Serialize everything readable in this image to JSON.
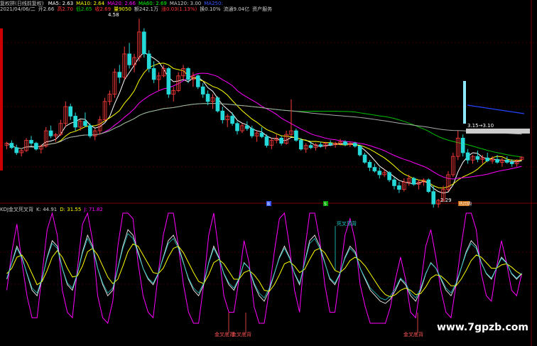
{
  "header": {
    "title": "复权拼(日线前复权)",
    "ma": [
      {
        "label": "MA5: 2.63",
        "color": "#ffffff"
      },
      {
        "label": "MA10: 2.64",
        "color": "#ffff00"
      },
      {
        "label": "MA20: 2.66",
        "color": "#ff00ff"
      },
      {
        "label": "MA60: 2.69",
        "color": "#00ff00"
      },
      {
        "label": "MA120: 3.00",
        "color": "#cccccc"
      },
      {
        "label": "MA250:",
        "color": "#3355ff"
      }
    ],
    "info": [
      {
        "label": "2021/04/06/二",
        "color": "#cccccc"
      },
      {
        "label": "开2.66",
        "color": "#cccccc"
      },
      {
        "label": "高2.70",
        "color": "#ff3333"
      },
      {
        "label": "低2.65",
        "color": "#00cc00"
      },
      {
        "label": "收2.69",
        "color": "#ff3333"
      },
      {
        "label": "量9050",
        "color": "#ffff00"
      },
      {
        "label": "额242.1万",
        "color": "#cccccc"
      },
      {
        "label": "涨0.03(1.13%)",
        "color": "#ff3333"
      },
      {
        "label": "换0.10%",
        "color": "#cccccc"
      },
      {
        "label": "流通9.04亿",
        "color": "#cccccc"
      },
      {
        "label": "资产服务",
        "color": "#cccccc"
      }
    ]
  },
  "kdj_header": [
    {
      "label": "KDJ金叉死叉背",
      "color": "#cccccc"
    },
    {
      "label": "K: 44.91",
      "color": "#cccccc"
    },
    {
      "label": "D: 31.55",
      "color": "#ffff00"
    },
    {
      "label": "J: 71.82",
      "color": "#ff00ff"
    }
  ],
  "markers": {
    "b1": "B",
    "b2": "S",
    "b3": "热回购"
  },
  "annotations": {
    "high": "4.58",
    "low": "2.29",
    "range": "3.15→3.10",
    "dead": "死叉顶背",
    "gold": [
      "金叉底背",
      "金叉底背",
      "金叉底背"
    ]
  },
  "colors": {
    "up": "#ff3b3b",
    "down": "#26d9d9",
    "grid": "#7a0000"
  },
  "watermark": "www.7gpzb.com",
  "chart_data": {
    "type": "candlestick",
    "price_range": [
      2.1,
      4.7
    ],
    "candles": [
      [
        2.85,
        2.9,
        2.8,
        2.88
      ],
      [
        2.88,
        2.92,
        2.8,
        2.82
      ],
      [
        2.82,
        2.86,
        2.72,
        2.75
      ],
      [
        2.75,
        2.8,
        2.7,
        2.78
      ],
      [
        2.78,
        2.95,
        2.76,
        2.92
      ],
      [
        2.92,
        2.98,
        2.85,
        2.88
      ],
      [
        2.88,
        2.9,
        2.78,
        2.8
      ],
      [
        2.8,
        2.86,
        2.74,
        2.84
      ],
      [
        2.84,
        3.1,
        2.82,
        3.05
      ],
      [
        3.05,
        3.12,
        2.95,
        2.98
      ],
      [
        2.98,
        3.02,
        2.9,
        3.0
      ],
      [
        3.0,
        3.2,
        2.98,
        3.15
      ],
      [
        3.15,
        3.45,
        3.1,
        3.38
      ],
      [
        3.38,
        3.42,
        3.2,
        3.25
      ],
      [
        3.25,
        3.3,
        3.05,
        3.1
      ],
      [
        3.1,
        3.2,
        3.05,
        3.18
      ],
      [
        3.18,
        3.3,
        3.1,
        3.12
      ],
      [
        3.12,
        3.15,
        2.95,
        2.98
      ],
      [
        2.98,
        3.08,
        2.92,
        3.05
      ],
      [
        3.05,
        3.25,
        3.0,
        3.2
      ],
      [
        3.2,
        3.5,
        3.18,
        3.45
      ],
      [
        3.45,
        3.6,
        3.4,
        3.55
      ],
      [
        3.55,
        3.9,
        3.5,
        3.85
      ],
      [
        3.85,
        3.95,
        3.7,
        3.78
      ],
      [
        3.78,
        4.2,
        3.75,
        4.1
      ],
      [
        4.1,
        4.25,
        3.9,
        3.95
      ],
      [
        3.95,
        4.1,
        3.85,
        4.05
      ],
      [
        4.05,
        4.58,
        4.0,
        4.4
      ],
      [
        4.4,
        4.45,
        4.05,
        4.1
      ],
      [
        4.1,
        4.15,
        3.85,
        3.9
      ],
      [
        3.9,
        4.0,
        3.7,
        3.75
      ],
      [
        3.75,
        3.85,
        3.6,
        3.8
      ],
      [
        3.8,
        3.95,
        3.78,
        3.9
      ],
      [
        3.9,
        3.92,
        3.5,
        3.55
      ],
      [
        3.55,
        3.65,
        3.45,
        3.6
      ],
      [
        3.6,
        3.85,
        3.58,
        3.8
      ],
      [
        3.8,
        3.95,
        3.75,
        3.9
      ],
      [
        3.9,
        3.92,
        3.7,
        3.75
      ],
      [
        3.75,
        3.85,
        3.65,
        3.8
      ],
      [
        3.8,
        3.82,
        3.62,
        3.65
      ],
      [
        3.65,
        3.7,
        3.5,
        3.55
      ],
      [
        3.55,
        3.6,
        3.4,
        3.45
      ],
      [
        3.45,
        3.55,
        3.35,
        3.5
      ],
      [
        3.5,
        3.52,
        3.3,
        3.32
      ],
      [
        3.32,
        3.38,
        3.15,
        3.2
      ],
      [
        3.2,
        3.28,
        3.1,
        3.25
      ],
      [
        3.25,
        3.3,
        3.12,
        3.15
      ],
      [
        3.15,
        3.18,
        3.0,
        3.05
      ],
      [
        3.05,
        3.15,
        3.02,
        3.12
      ],
      [
        3.12,
        3.18,
        3.05,
        3.08
      ],
      [
        3.08,
        3.12,
        2.95,
        2.98
      ],
      [
        2.98,
        3.05,
        2.9,
        3.02
      ],
      [
        3.02,
        3.1,
        2.95,
        2.97
      ],
      [
        2.97,
        3.0,
        2.82,
        2.85
      ],
      [
        2.85,
        2.95,
        2.8,
        2.92
      ],
      [
        2.92,
        3.0,
        2.88,
        2.95
      ],
      [
        2.95,
        2.98,
        2.85,
        2.88
      ],
      [
        2.88,
        3.05,
        2.86,
        3.0
      ],
      [
        3.0,
        3.48,
        2.98,
        3.05
      ],
      [
        3.05,
        3.08,
        2.9,
        2.92
      ],
      [
        2.92,
        2.95,
        2.78,
        2.8
      ],
      [
        2.8,
        2.88,
        2.75,
        2.85
      ],
      [
        2.85,
        2.9,
        2.8,
        2.82
      ],
      [
        2.82,
        2.88,
        2.78,
        2.86
      ],
      [
        2.86,
        2.9,
        2.82,
        2.84
      ],
      [
        2.84,
        2.9,
        2.8,
        2.88
      ],
      [
        2.88,
        2.92,
        2.84,
        2.86
      ],
      [
        2.86,
        2.9,
        2.82,
        2.88
      ],
      [
        2.88,
        2.94,
        2.85,
        2.9
      ],
      [
        2.9,
        2.92,
        2.84,
        2.86
      ],
      [
        2.86,
        2.9,
        2.83,
        2.88
      ],
      [
        2.88,
        2.9,
        2.82,
        2.84
      ],
      [
        2.84,
        2.86,
        2.7,
        2.72
      ],
      [
        2.72,
        2.75,
        2.6,
        2.62
      ],
      [
        2.62,
        2.65,
        2.5,
        2.55
      ],
      [
        2.55,
        2.6,
        2.48,
        2.5
      ],
      [
        2.5,
        2.55,
        2.4,
        2.45
      ],
      [
        2.45,
        2.52,
        2.42,
        2.48
      ],
      [
        2.48,
        2.5,
        2.35,
        2.38
      ],
      [
        2.38,
        2.42,
        2.25,
        2.3
      ],
      [
        2.3,
        2.35,
        2.2,
        2.25
      ],
      [
        2.25,
        2.4,
        2.22,
        2.35
      ],
      [
        2.35,
        2.45,
        2.3,
        2.4
      ],
      [
        2.4,
        2.42,
        2.3,
        2.32
      ],
      [
        2.32,
        2.38,
        2.25,
        2.35
      ],
      [
        2.35,
        2.4,
        2.3,
        2.38
      ],
      [
        2.38,
        2.4,
        2.2,
        2.22
      ],
      [
        2.22,
        2.3,
        2.0,
        2.05
      ],
      [
        2.05,
        2.12,
        2.0,
        2.1
      ],
      [
        2.1,
        2.3,
        2.08,
        2.25
      ],
      [
        2.25,
        2.5,
        2.22,
        2.45
      ],
      [
        2.45,
        2.75,
        2.42,
        2.7
      ],
      [
        2.7,
        3.05,
        2.65,
        2.95
      ],
      [
        2.95,
        3.0,
        2.7,
        2.75
      ],
      [
        2.75,
        2.8,
        2.6,
        2.65
      ],
      [
        2.65,
        2.72,
        2.6,
        2.7
      ],
      [
        2.7,
        2.78,
        2.62,
        2.66
      ],
      [
        2.66,
        2.72,
        2.6,
        2.68
      ],
      [
        2.68,
        2.75,
        2.62,
        2.64
      ],
      [
        2.64,
        2.7,
        2.6,
        2.66
      ],
      [
        2.66,
        2.72,
        2.6,
        2.62
      ],
      [
        2.62,
        2.68,
        2.56,
        2.65
      ],
      [
        2.65,
        2.7,
        2.6,
        2.62
      ],
      [
        2.62,
        2.66,
        2.56,
        2.6
      ],
      [
        2.6,
        2.66,
        2.56,
        2.64
      ],
      [
        2.66,
        2.7,
        2.65,
        2.69
      ]
    ],
    "kdj": {
      "k": [
        40,
        55,
        70,
        60,
        45,
        30,
        25,
        40,
        60,
        75,
        70,
        50,
        35,
        30,
        45,
        65,
        80,
        70,
        50,
        35,
        25,
        30,
        50,
        70,
        85,
        80,
        65,
        50,
        40,
        35,
        45,
        60,
        75,
        80,
        70,
        55,
        40,
        30,
        25,
        35,
        55,
        70,
        60,
        45,
        35,
        30,
        40,
        55,
        50,
        35,
        25,
        20,
        30,
        45,
        60,
        70,
        60,
        45,
        35,
        55,
        75,
        80,
        70,
        55,
        40,
        35,
        45,
        60,
        70,
        65,
        50,
        40,
        30,
        25,
        20,
        18,
        22,
        30,
        40,
        35,
        25,
        20,
        30,
        45,
        55,
        50,
        40,
        30,
        25,
        35,
        50,
        65,
        75,
        70,
        55,
        45,
        40,
        50,
        60,
        55,
        45,
        40,
        45
      ],
      "d": [
        45,
        50,
        60,
        62,
        55,
        45,
        35,
        38,
        48,
        60,
        66,
        60,
        50,
        42,
        43,
        52,
        65,
        68,
        62,
        52,
        42,
        36,
        40,
        52,
        65,
        72,
        70,
        62,
        54,
        46,
        45,
        50,
        60,
        68,
        70,
        64,
        55,
        46,
        38,
        36,
        44,
        55,
        58,
        54,
        47,
        40,
        40,
        46,
        48,
        44,
        38,
        30,
        29,
        35,
        44,
        54,
        56,
        52,
        46,
        49,
        58,
        66,
        68,
        64,
        56,
        48,
        46,
        50,
        57,
        60,
        57,
        52,
        45,
        38,
        31,
        26,
        24,
        26,
        30,
        32,
        30,
        26,
        27,
        33,
        41,
        44,
        43,
        39,
        34,
        34,
        40,
        48,
        57,
        62,
        60,
        55,
        50,
        50,
        53,
        54,
        51,
        47,
        44
      ],
      "j": [
        30,
        65,
        90,
        55,
        25,
        5,
        5,
        45,
        85,
        100,
        80,
        30,
        10,
        5,
        50,
        90,
        100,
        75,
        25,
        5,
        0,
        20,
        70,
        100,
        100,
        95,
        55,
        25,
        10,
        5,
        45,
        80,
        100,
        100,
        70,
        35,
        10,
        0,
        0,
        35,
        80,
        100,
        65,
        25,
        10,
        10,
        40,
        75,
        55,
        15,
        0,
        0,
        30,
        65,
        95,
        100,
        70,
        30,
        10,
        65,
        100,
        100,
        75,
        35,
        10,
        10,
        45,
        80,
        95,
        75,
        35,
        15,
        0,
        0,
        0,
        0,
        15,
        40,
        60,
        40,
        10,
        5,
        35,
        70,
        85,
        60,
        30,
        10,
        5,
        35,
        70,
        100,
        100,
        85,
        45,
        25,
        20,
        50,
        75,
        55,
        30,
        25,
        45
      ]
    }
  }
}
